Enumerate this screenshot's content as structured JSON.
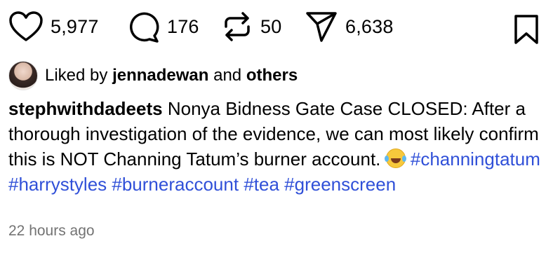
{
  "actions": {
    "likes": "5,977",
    "comments": "176",
    "reposts": "50",
    "shares": "6,638"
  },
  "liked_by": {
    "prefix": "Liked by",
    "user": "jennadewan",
    "and": "and",
    "others": "others"
  },
  "caption": {
    "username": "stephwithdadeets",
    "text": "Nonya Bidness Gate Case CLOSED: After a thorough investigation of the evidence, we can most likely confirm this is NOT Channing Tatum’s burner account.",
    "emoji": "😂",
    "hashtags": [
      "#channingtatum",
      "#harrystyles",
      "#burneraccount",
      "#tea",
      "#greenscreen"
    ]
  },
  "timestamp": "22 hours ago"
}
